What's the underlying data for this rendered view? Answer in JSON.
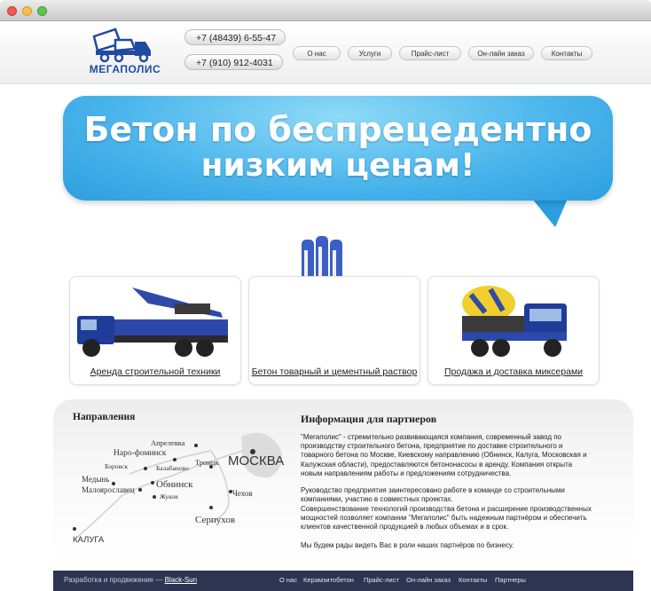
{
  "header": {
    "logo_text": "МЕГАПОЛИС",
    "phones": [
      "+7 (48439) 6-55-47",
      "+7 (910) 912-4031"
    ],
    "nav": [
      "О нас",
      "Услуги",
      "Прайс-лист",
      "Он-лайн заказ",
      "Контакты"
    ]
  },
  "hero": {
    "line1": "Бетон по беспрецедентно",
    "line2": "низким ценам!"
  },
  "cards": [
    {
      "label": "Аренда строительной техники"
    },
    {
      "label": "Бетон товарный и цементный раствор"
    },
    {
      "label": "Продажа и доставка миксерами"
    }
  ],
  "directions": {
    "title": "Направления",
    "cities": [
      "Апрелевка",
      "Наро-фоминск",
      "Боровск",
      "Балабаново",
      "Троицк",
      "МОСКВА",
      "Медынь",
      "Обнинск",
      "Малоярославец",
      "Жуков",
      "Чехов",
      "Серпухов",
      "КАЛУГА"
    ]
  },
  "partners": {
    "title": "Информация для партнеров",
    "p1": "\"Мегаполис\" - стремительно развивающаяся компания, современный завод по производству строительного бетона, предприятие по доставке строительного и товарного бетона по Москве, Киевскому направлению (Обнинск, Калуга, Московская и Калужская области), предоставляются бетононасосы в аренду. Компания открыта новым направлениям работы и предложениям сотрудничества.",
    "p2": "Руководство предприятия заинтересовано работе в команде со строительными компаниями, участию в совместных проектах.",
    "p3": "Совершенствование технологий производства бетона и расширение производственных мощностей позволяет компании \"Мегаполис\" быть надежным партнёром и обеспечить клиентов качественной продукцией в любых объемах и в срок.",
    "p4": "Мы будем рады видеть Вас в роли наших партнёров по бизнесу."
  },
  "footer": {
    "credit_prefix": "Разработка и продвижение —",
    "credit_link": "Black-Sun",
    "links": [
      "О нас",
      "Керамзитобетон",
      "Прайс-лист",
      "Он-лайн заказ",
      "Контакты",
      "Партнеры"
    ]
  },
  "colors": {
    "brand_blue": "#1f4aa3",
    "hero_blue": "#4cb6ec",
    "footer_bg": "#2d3551"
  }
}
